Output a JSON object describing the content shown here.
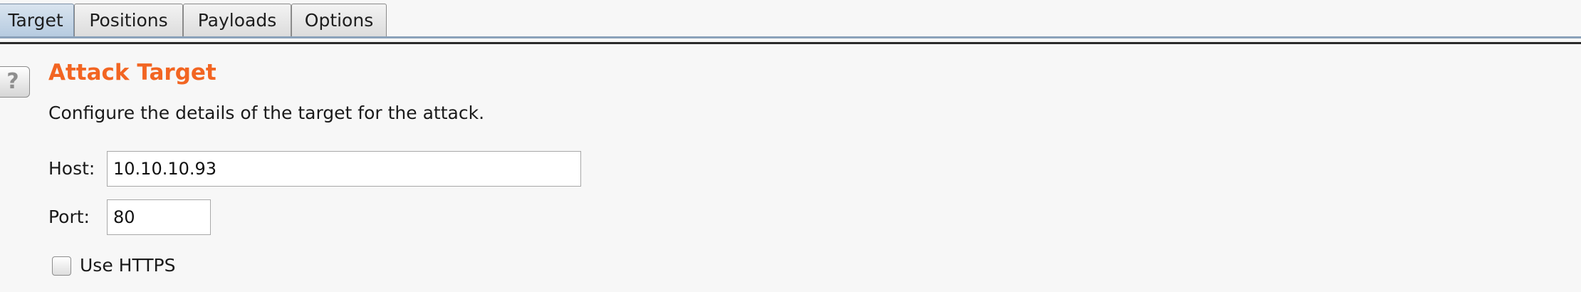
{
  "tabs": [
    {
      "label": "Target",
      "active": true
    },
    {
      "label": "Positions",
      "active": false
    },
    {
      "label": "Payloads",
      "active": false
    },
    {
      "label": "Options",
      "active": false
    }
  ],
  "section": {
    "help_label": "?",
    "title": "Attack Target",
    "description": "Configure the details of the target for the attack."
  },
  "fields": {
    "host": {
      "label": "Host:",
      "value": "10.10.10.93"
    },
    "port": {
      "label": "Port:",
      "value": "80"
    },
    "use_https": {
      "label": "Use HTTPS",
      "checked": false
    }
  },
  "colors": {
    "title": "#f26522",
    "active_tab": "#b6cbe0",
    "background": "#f7f7f7"
  }
}
